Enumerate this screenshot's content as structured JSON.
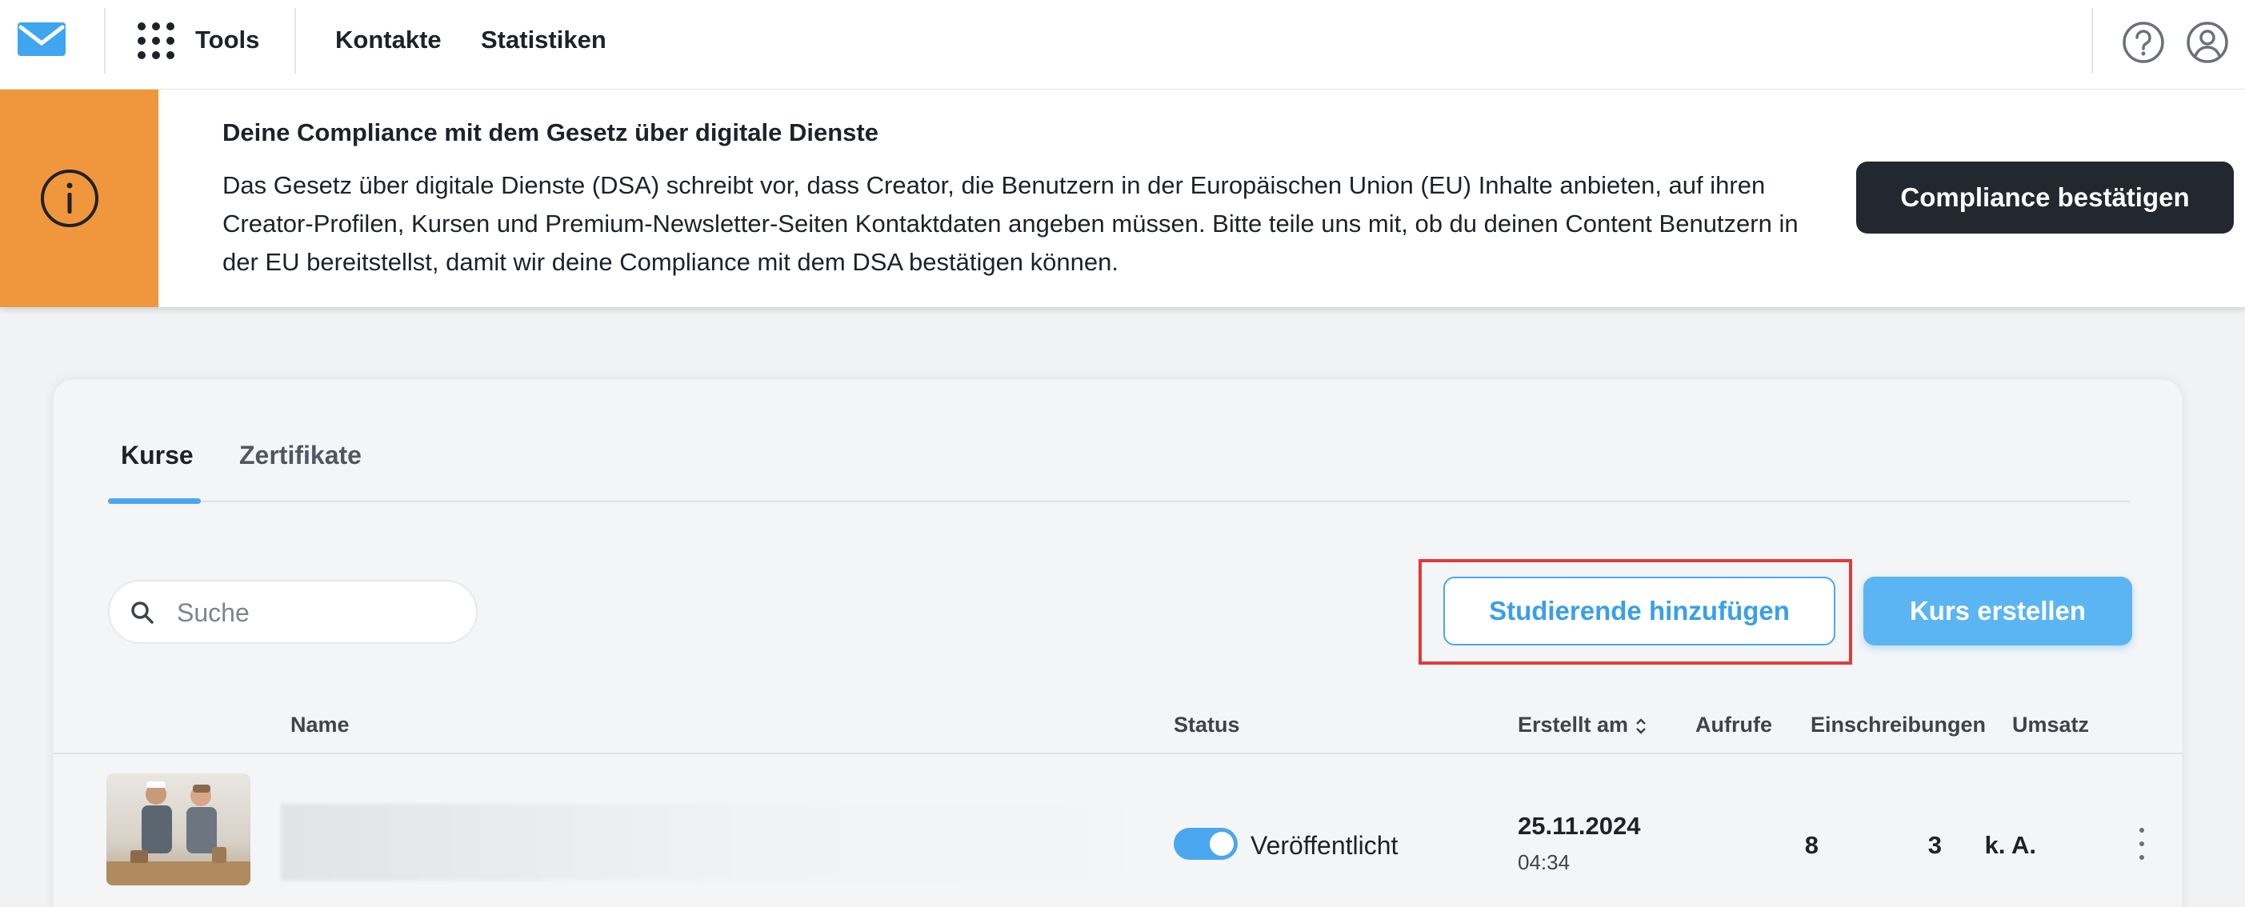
{
  "nav": {
    "logo_icon": "envelope-logo-icon",
    "apps_icon": "grid-apps-icon",
    "tools_label": "Tools",
    "links": [
      "Kontakte",
      "Statistiken"
    ],
    "help_icon": "help-icon",
    "profile_icon": "user-profile-icon"
  },
  "banner": {
    "icon": "info-icon",
    "accent_color": "#f0963c",
    "title": "Deine Compliance mit dem Gesetz über digitale Dienste",
    "lines": [
      "Das Gesetz über digitale Dienste (DSA) schreibt vor, dass Creator, die Benutzern in der Europäischen Union (EU) Inhalte anbieten, auf ihren",
      "Creator-Profilen, Kursen und Premium-Newsletter-Seiten Kontaktdaten angeben müssen. Bitte teile uns mit, ob du deinen Content Benutzern in",
      "der EU bereitstellst, damit wir deine Compliance mit dem DSA bestätigen können."
    ],
    "button_label": "Compliance bestätigen"
  },
  "tabs": {
    "items": [
      "Kurse",
      "Zertifikate"
    ],
    "active": "Kurse",
    "accent_color": "#4aa7ef"
  },
  "search": {
    "placeholder": "Suche",
    "value": ""
  },
  "actions": {
    "add_students_label": "Studierende hinzufügen",
    "create_course_label": "Kurs erstellen",
    "highlight_color": "#e03b3b"
  },
  "table": {
    "headers": {
      "name": "Name",
      "status": "Status",
      "created": "Erstellt am",
      "views": "Aufrufe",
      "enrollments": "Einschreibungen",
      "revenue": "Umsatz"
    },
    "rows": [
      {
        "name": "",
        "published": true,
        "status": "Veröffentlicht",
        "date": "25.11.2024",
        "time": "04:34",
        "views": "8",
        "enrollments": "3",
        "revenue": "k. A."
      }
    ]
  }
}
